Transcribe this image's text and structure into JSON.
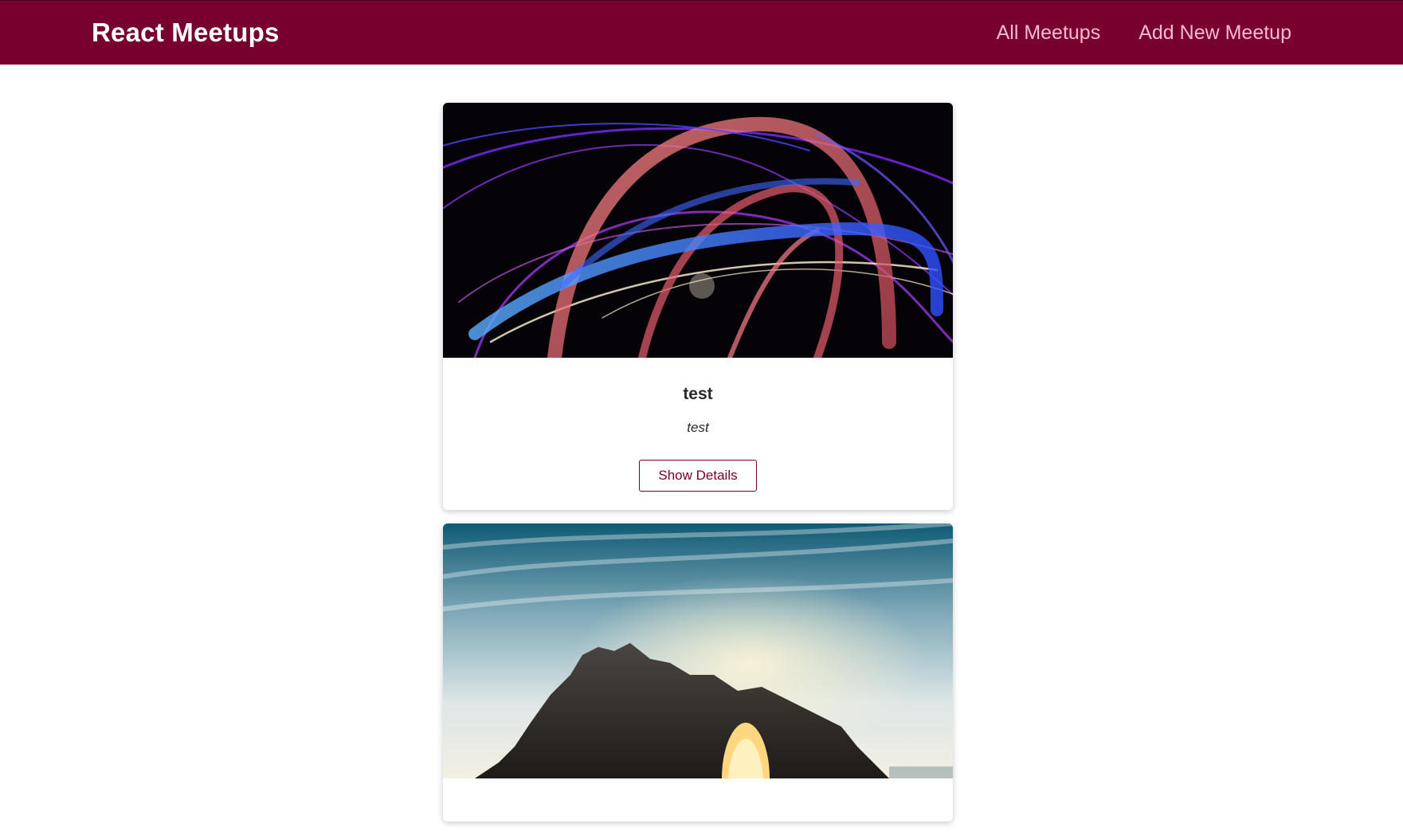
{
  "header": {
    "logo": "React Meetups",
    "nav": [
      {
        "label": "All Meetups"
      },
      {
        "label": "Add New Meetup"
      }
    ]
  },
  "meetups": [
    {
      "title": "test",
      "description": "test",
      "action_label": "Show Details"
    },
    {
      "title": "",
      "description": "",
      "action_label": ""
    }
  ],
  "colors": {
    "brand": "#77002e",
    "nav_link": "#fcb8d6",
    "text": "#2c292b"
  }
}
